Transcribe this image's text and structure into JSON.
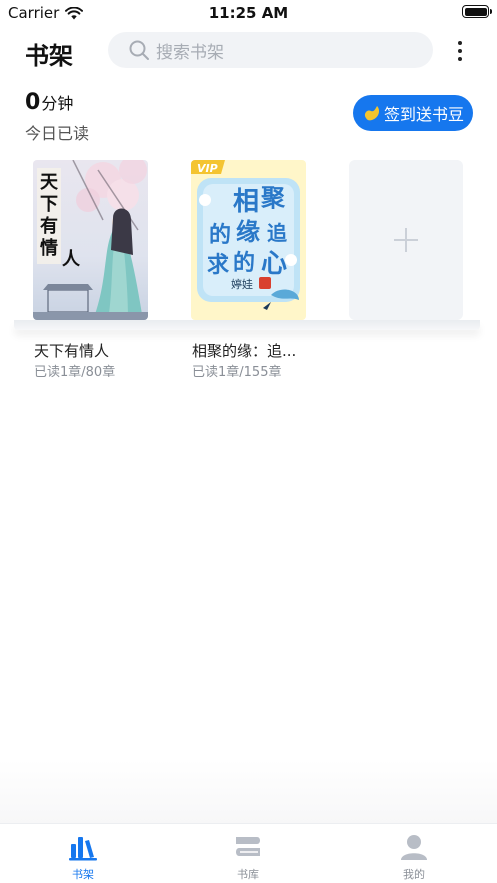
{
  "status": {
    "carrier": "Carrier",
    "time": "11:25 AM"
  },
  "header": {
    "title": "书架",
    "search_placeholder": "搜索书架"
  },
  "stats": {
    "minutes": "0",
    "minutes_unit": "分钟",
    "label": "今日已读"
  },
  "signin": {
    "label": "签到送书豆"
  },
  "books": [
    {
      "title": "天下有情人",
      "progress": "已读1章/80章",
      "cover_text": "天下有情人"
    },
    {
      "title": "相聚的缘：追...",
      "progress": "已读1章/155章",
      "cover_text": "相聚的缘追求的心",
      "badge": "VIP",
      "author": "婷娃"
    }
  ],
  "tabs": [
    {
      "label": "书架",
      "icon": "bookshelf-icon",
      "active": true
    },
    {
      "label": "书库",
      "icon": "library-icon",
      "active": false
    },
    {
      "label": "我的",
      "icon": "profile-icon",
      "active": false
    }
  ],
  "colors": {
    "accent": "#1677ee",
    "inactive": "#b8bdc6"
  }
}
